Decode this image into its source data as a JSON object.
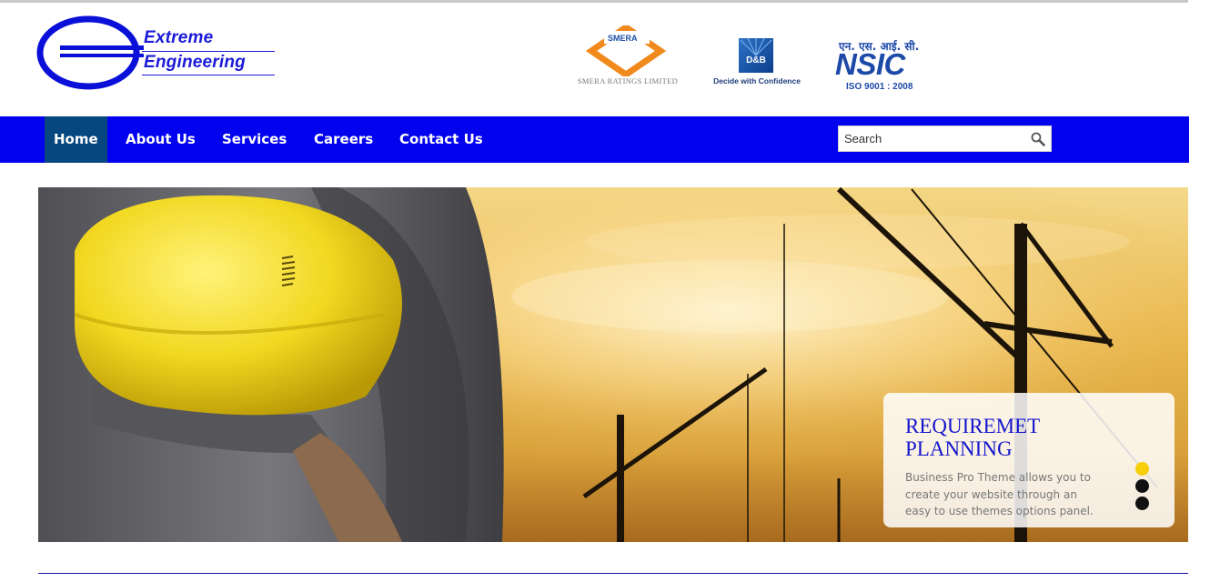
{
  "brand": {
    "line1": "Extreme",
    "line2": "Engineering",
    "color": "#1a1ad9"
  },
  "badges": {
    "smera_brand": "SMERA",
    "smera_caption": "SMERA RATINGS LIMITED",
    "dnb_mark": "D&B",
    "dnb_caption": "Decide with Confidence",
    "nsic_hindi": "एन. एस. आई. सी.",
    "nsic_mark": "NSIC",
    "nsic_iso": "ISO 9001 : 2008"
  },
  "nav": {
    "background": "#0202ee",
    "active_background": "#06477f",
    "items": [
      {
        "label": "Home",
        "active": true
      },
      {
        "label": "About Us"
      },
      {
        "label": "Services"
      },
      {
        "label": "Careers"
      },
      {
        "label": "Contact Us"
      }
    ],
    "search": {
      "placeholder": "Search",
      "icon": "search-icon"
    }
  },
  "slider": {
    "title": "REQUIREMET PLANNING",
    "text": "Business Pro Theme allows you to create your website through an easy to use themes options panel.",
    "slide_count": 3,
    "active_slide": 1,
    "active_dot_color": "#f5cf0a"
  }
}
